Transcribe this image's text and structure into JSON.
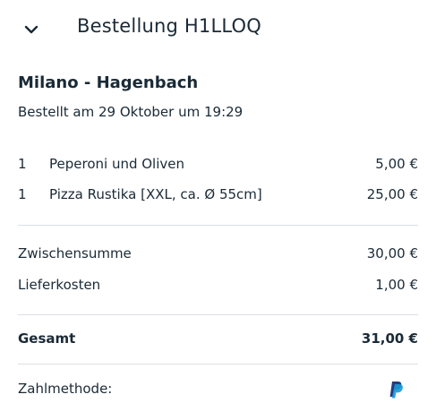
{
  "header": {
    "title": "Bestellung H1LLOQ",
    "back_icon": "chevron-down-icon"
  },
  "order": {
    "restaurant": "Milano - Hagenbach",
    "ordered_at": "Bestellt am 29 Oktober um 19:29",
    "items": [
      {
        "qty": "1",
        "name": "Peperoni und Oliven",
        "price": "5,00 €"
      },
      {
        "qty": "1",
        "name": "Pizza Rustika [XXL, ca. Ø 55cm]",
        "price": "25,00 €"
      }
    ]
  },
  "summary": {
    "subtotal_label": "Zwischensumme",
    "subtotal_value": "30,00 €",
    "delivery_label": "Lieferkosten",
    "delivery_value": "1,00 €",
    "total_label": "Gesamt",
    "total_value": "31,00 €"
  },
  "payment": {
    "label": "Zahlmethode:",
    "method_icon": "paypal-icon",
    "colors": {
      "dark": "#253B80",
      "light": "#179BD7"
    }
  }
}
